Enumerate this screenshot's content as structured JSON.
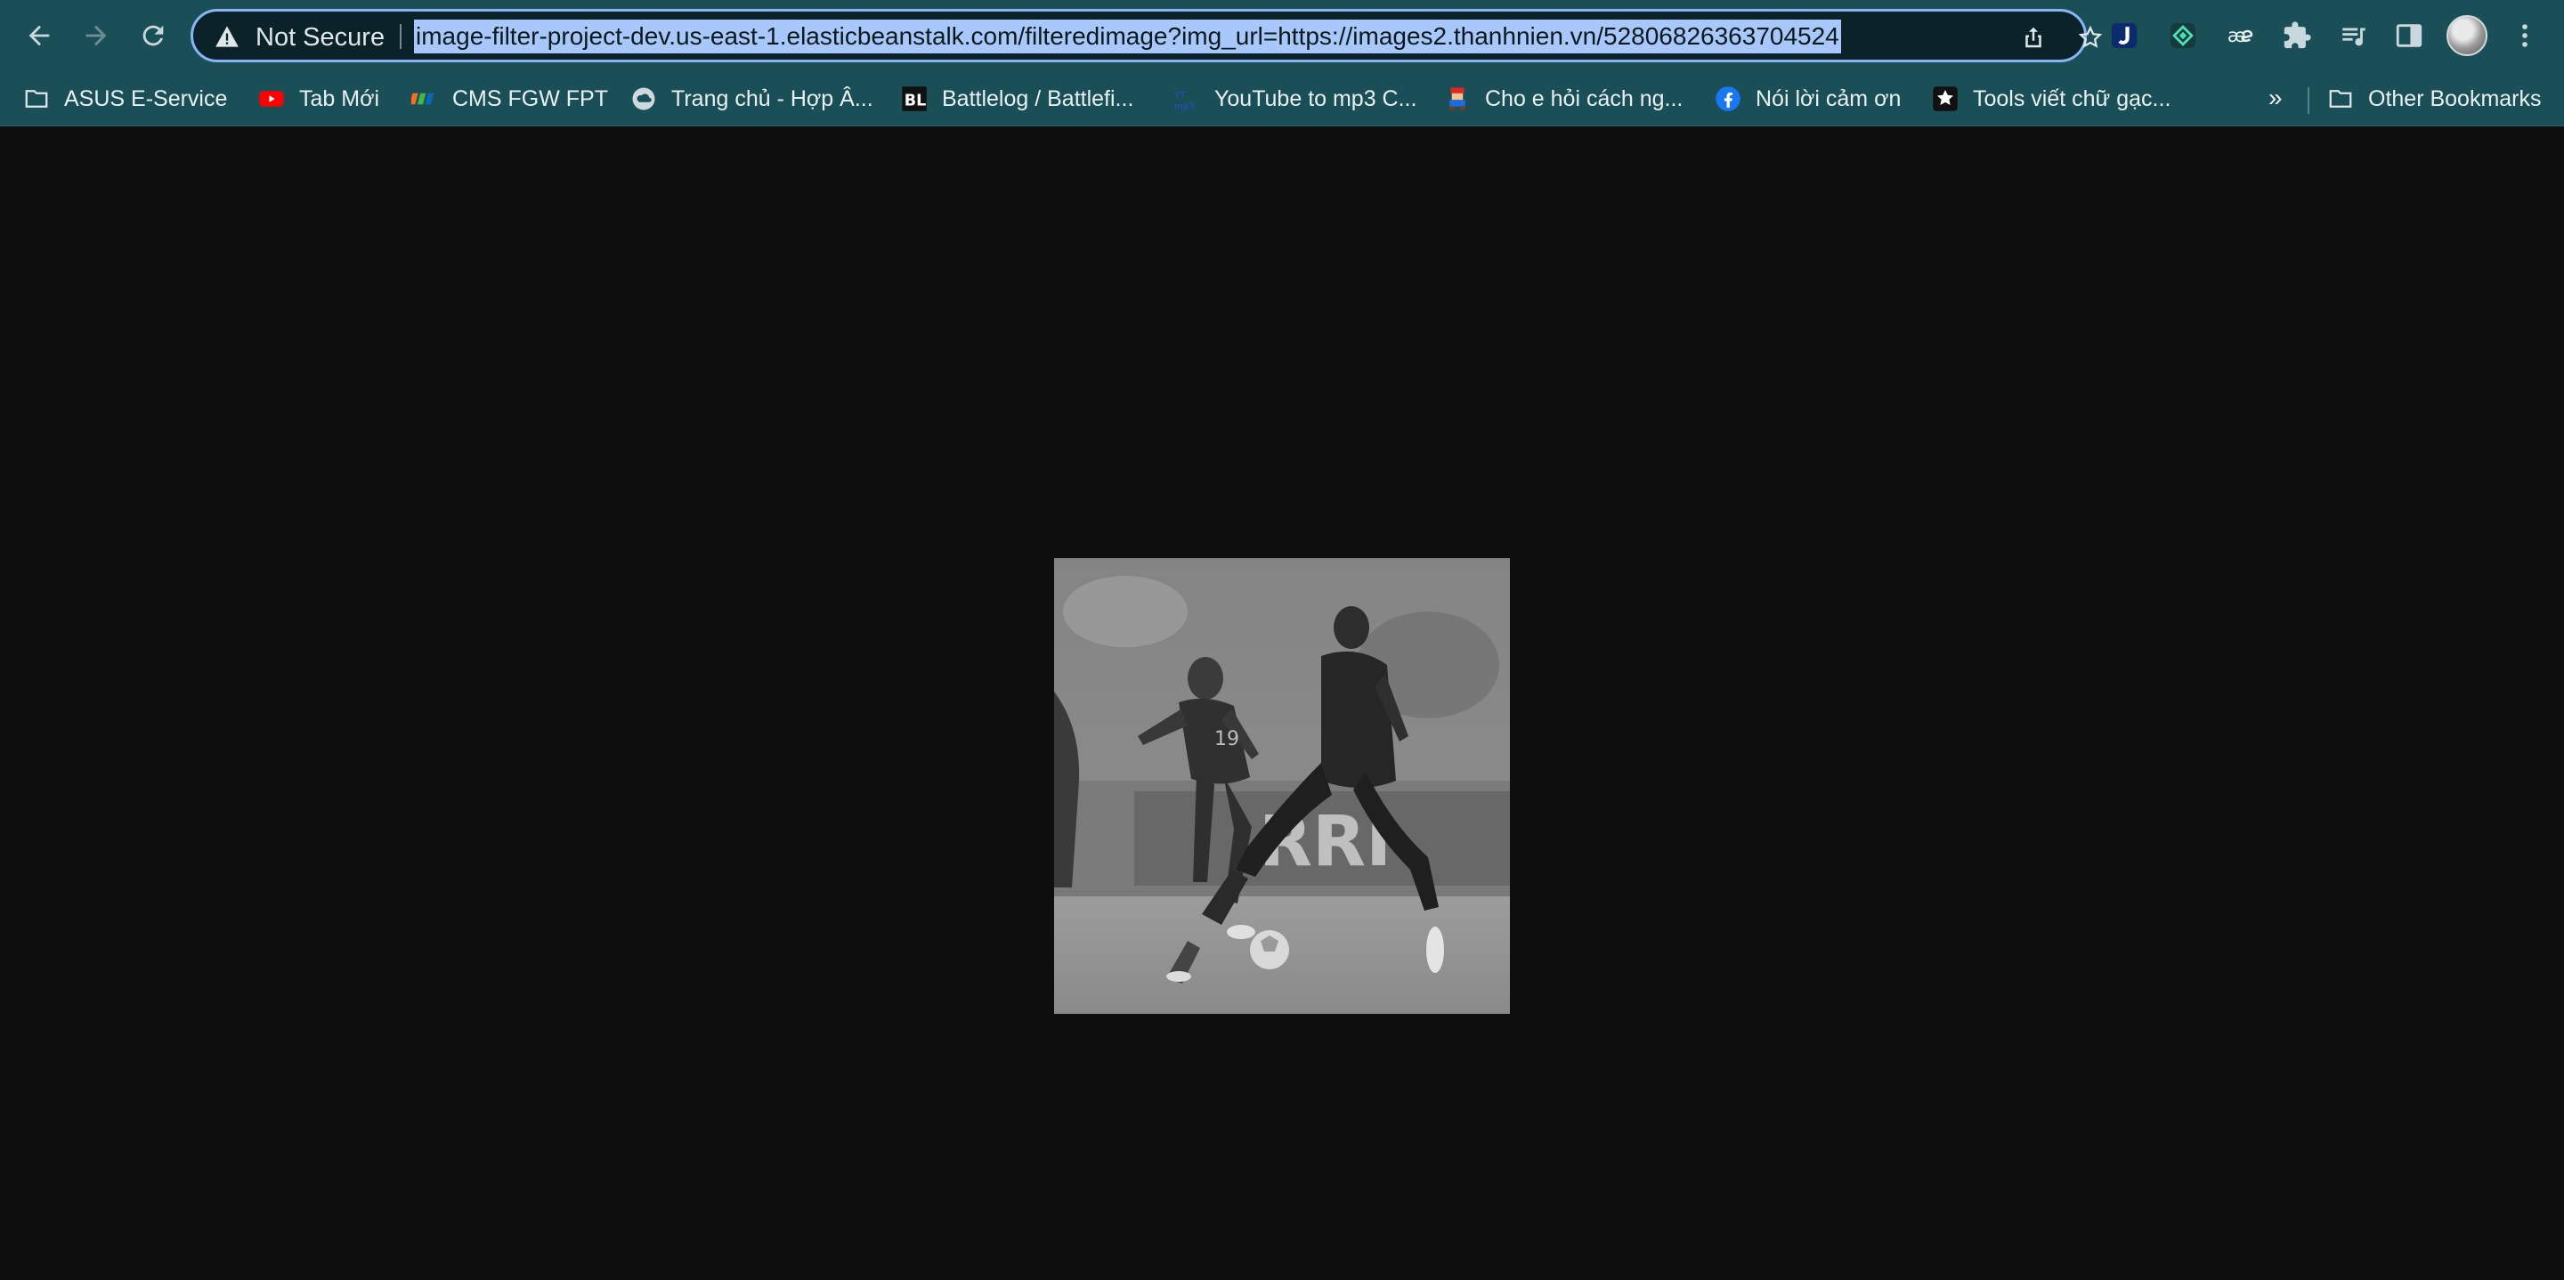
{
  "toolbar": {
    "back_icon": "arrow-left-icon",
    "forward_icon": "arrow-right-icon",
    "reload_icon": "reload-icon",
    "security_label": "Not Secure",
    "security_icon": "warning-triangle-icon",
    "url": "image-filter-project-dev.us-east-1.elasticbeanstalk.com/filteredimage?img_url=https://images2.thanhnien.vn/52806826363704524",
    "share_icon": "share-icon",
    "bookmark_star_icon": "star-icon",
    "extensions": [
      "j-extension-icon",
      "diamond-extension-icon",
      "ae-extension-icon",
      "puzzle-icon",
      "media-queue-icon",
      "side-panel-icon"
    ],
    "profile_icon": "avatar",
    "menu_icon": "kebab-menu-icon"
  },
  "bookmarks": {
    "items": [
      {
        "label": "ASUS E-Service",
        "icon": "folder-icon"
      },
      {
        "label": "Tab Mới",
        "icon": "youtube-icon"
      },
      {
        "label": "CMS FGW FPT",
        "icon": "fpt-icon"
      },
      {
        "label": "Trang chủ - Hợp Â...",
        "icon": "cloud-icon"
      },
      {
        "label": "Battlelog / Battlefi...",
        "icon": "bl-icon"
      },
      {
        "label": "YouTube to mp3 C...",
        "icon": "mp3-icon"
      },
      {
        "label": "Cho e hỏi cách ng...",
        "icon": "mario-icon"
      },
      {
        "label": "Nói lời cảm ơn",
        "icon": "facebook-icon"
      },
      {
        "label": "Tools viết chữ gạc...",
        "icon": "star-box-icon"
      }
    ],
    "overflow_icon": "chevron-double-right-icon",
    "other_label": "Other Bookmarks",
    "other_icon": "folder-icon"
  },
  "content": {
    "image_description_icon": "filtered-grayscale-photo"
  },
  "colors": {
    "toolbar_bg": "#1b4f57",
    "page_bg": "#0e0e0e",
    "url_highlight": "#a8c7fa",
    "omnibox_border": "#8ab4f8"
  }
}
